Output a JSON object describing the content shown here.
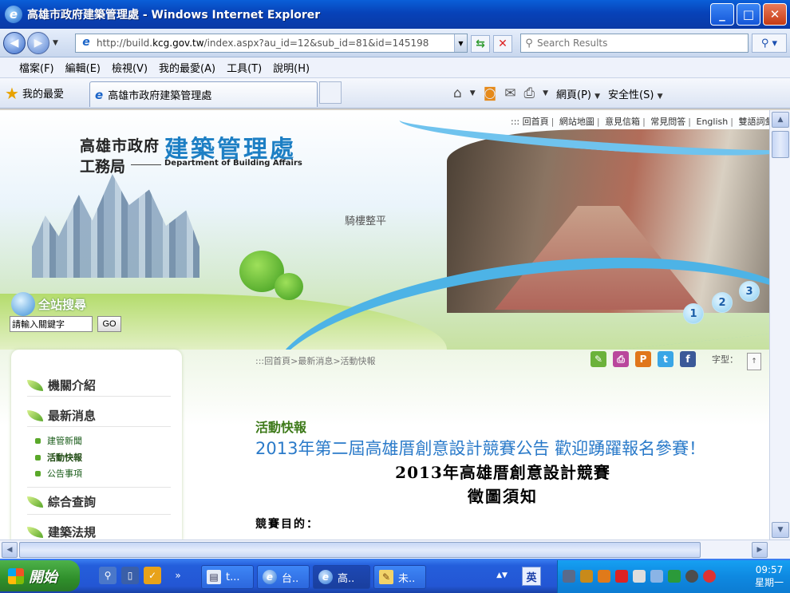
{
  "window": {
    "title": "高雄市政府建築管理處 - Windows Internet Explorer",
    "minimize": "_",
    "maximize": "□",
    "close": "✕"
  },
  "address_bar": {
    "url_prefix": "http://build.",
    "url_domain": "kcg.gov.tw",
    "url_rest": "/index.aspx?au_id=12&sub_id=81&id=145198",
    "search_placeholder": "Search Results"
  },
  "menu": [
    "檔案(F)",
    "編輯(E)",
    "檢視(V)",
    "我的最愛(A)",
    "工具(T)",
    "說明(H)"
  ],
  "favorites_label": "我的最愛",
  "tab_title": "高雄市政府建築管理處",
  "command_bar": {
    "page": "網頁(P)",
    "safety": "安全性(S)"
  },
  "site": {
    "org_name": "高雄市政府",
    "org_sub": "工務局",
    "dept_name": "建築管理處",
    "dept_en": "Department of Building Affairs",
    "top_links": [
      "::: 回首頁",
      "網站地圖",
      "意見信箱",
      "常見問答",
      "English",
      "雙語詞彙"
    ],
    "banner_caption": "騎樓整平",
    "slide_numbers": [
      "1",
      "2",
      "3"
    ],
    "search_title": "全站搜尋",
    "search_placeholder": "請輸入關鍵字",
    "search_button": "GO",
    "menu_items": [
      {
        "label": "機關介紹"
      },
      {
        "label": "最新消息"
      },
      {
        "label": "綜合查詢"
      },
      {
        "label": "建築法規"
      }
    ],
    "sub_items": [
      "建管新聞",
      "活動快報",
      "公告事項"
    ],
    "breadcrumb": ":::回首頁>最新消息>活動快報",
    "font_size_label": "字型："
  },
  "article": {
    "section": "活動快報",
    "title": "2013年第二屆高雄厝創意設計競賽公告 歡迎踴躍報名參賽！",
    "heading1": "2013年高雄厝創意設計競賽",
    "heading2": "徵圖須知",
    "label": "競賽目的："
  },
  "taskbar": {
    "start": "開始",
    "tasks": [
      "t...",
      "台..",
      "高..",
      "未.."
    ],
    "lang": "英",
    "time": "09:57",
    "day": "星期一"
  }
}
